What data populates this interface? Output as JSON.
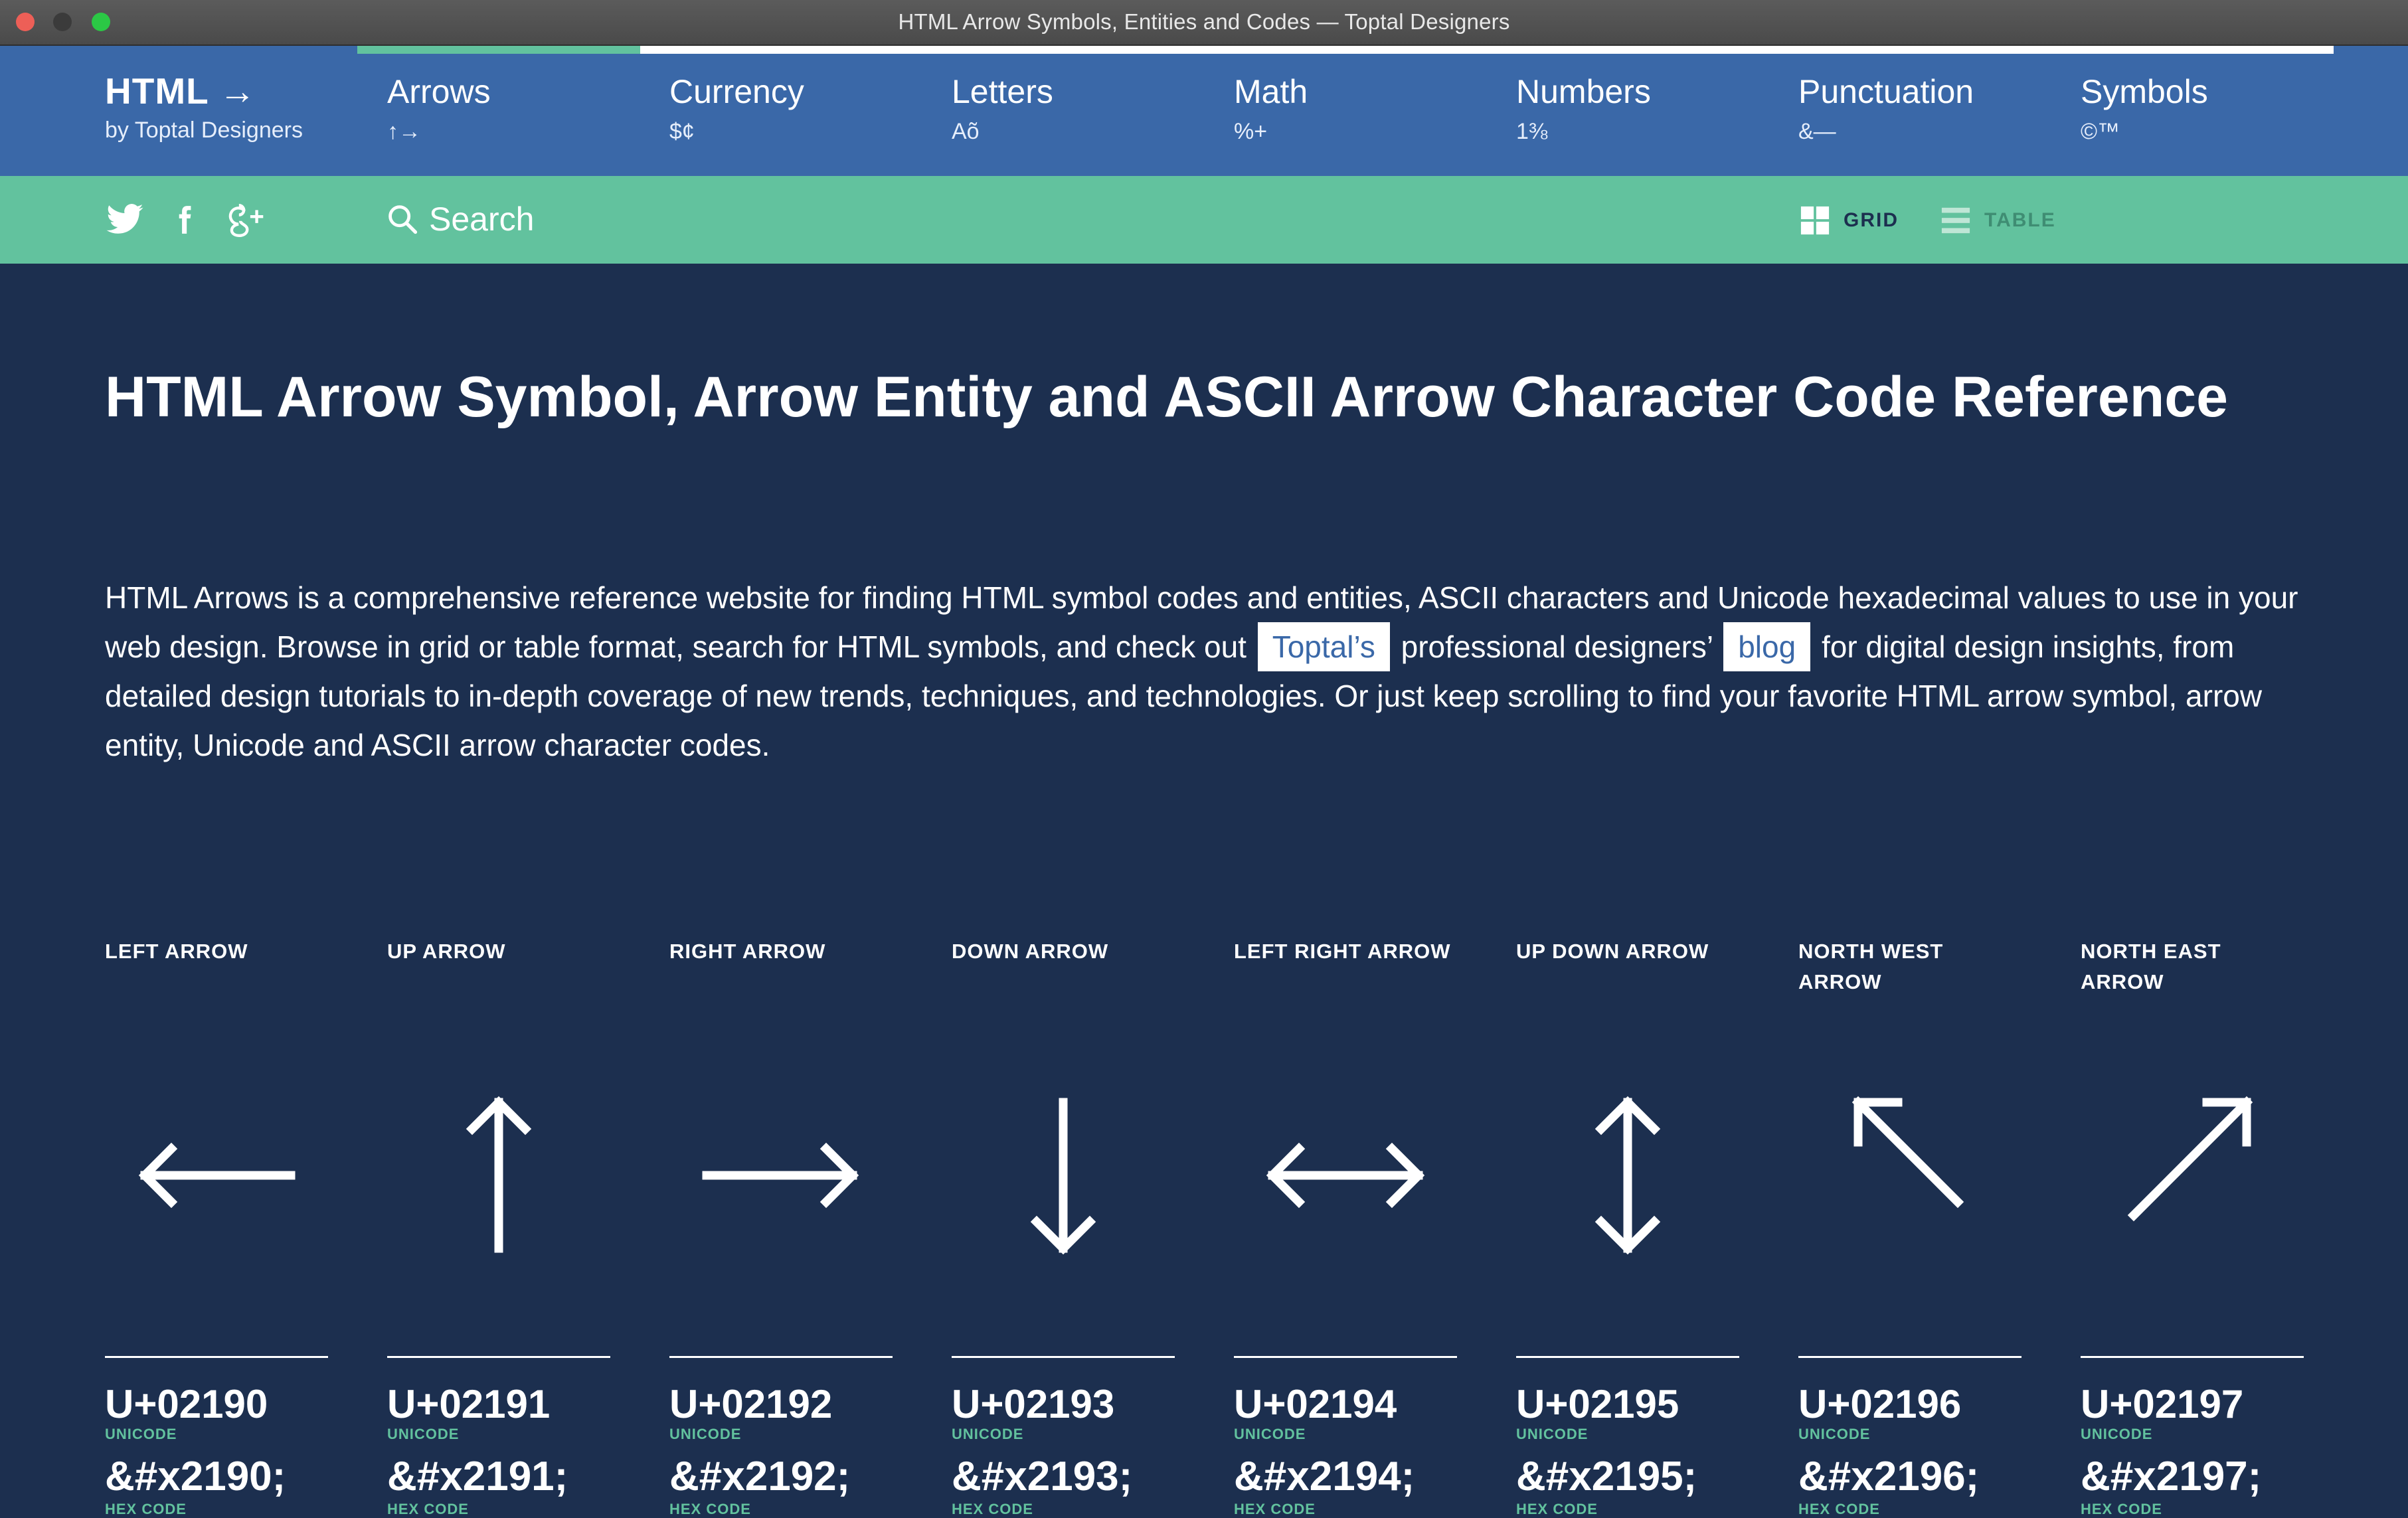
{
  "window": {
    "title": "HTML Arrow Symbols, Entities and Codes — Toptal Designers"
  },
  "brand": {
    "title": "HTML →",
    "subtitle": "by Toptal Designers"
  },
  "nav": {
    "items": [
      {
        "label": "Arrows",
        "sub": "↑→",
        "active": true
      },
      {
        "label": "Currency",
        "sub": "$¢"
      },
      {
        "label": "Letters",
        "sub": "Aõ"
      },
      {
        "label": "Math",
        "sub": "%+"
      },
      {
        "label": "Numbers",
        "sub": "1⅜"
      },
      {
        "label": "Punctuation",
        "sub": "&—"
      },
      {
        "label": "Symbols",
        "sub": "©™"
      }
    ],
    "progress_fraction": 0.143
  },
  "toolbar": {
    "social": [
      "twitter-icon",
      "facebook-icon",
      "google-plus-icon"
    ],
    "search_label": "Search",
    "grid_label": "GRID",
    "table_label": "TABLE"
  },
  "main": {
    "heading": "HTML Arrow Symbol, Arrow Entity and ASCII Arrow Character Code Reference",
    "intro_1": "HTML Arrows is a comprehensive reference website for finding HTML symbol codes and entities, ASCII characters and Unicode hexadecimal values to use in your web design. Browse in grid or table format, search for HTML symbols, and check out",
    "intro_link_1": "Toptal’s",
    "intro_2": "professional designers’",
    "intro_link_2": "blog",
    "intro_3": "for digital design insights, from detailed design tutorials to in-depth coverage of new trends, techniques, and technologies. Or just keep scrolling to find your favorite HTML arrow symbol, arrow entity, Unicode and ASCII arrow character codes."
  },
  "arrows": [
    {
      "name": "LEFT ARROW",
      "unicode": "U+02190",
      "hex": "&#x2190;",
      "icon": "left-arrow-icon"
    },
    {
      "name": "UP ARROW",
      "unicode": "U+02191",
      "hex": "&#x2191;",
      "icon": "up-arrow-icon"
    },
    {
      "name": "RIGHT ARROW",
      "unicode": "U+02192",
      "hex": "&#x2192;",
      "icon": "right-arrow-icon"
    },
    {
      "name": "DOWN ARROW",
      "unicode": "U+02193",
      "hex": "&#x2193;",
      "icon": "down-arrow-icon"
    },
    {
      "name": "LEFT RIGHT ARROW",
      "unicode": "U+02194",
      "hex": "&#x2194;",
      "icon": "left-right-arrow-icon"
    },
    {
      "name": "UP DOWN ARROW",
      "unicode": "U+02195",
      "hex": "&#x2195;",
      "icon": "up-down-arrow-icon"
    },
    {
      "name": "NORTH WEST ARROW",
      "unicode": "U+02196",
      "hex": "&#x2196;",
      "icon": "north-west-arrow-icon"
    },
    {
      "name": "NORTH EAST ARROW",
      "unicode": "U+02197",
      "hex": "&#x2197;",
      "icon": "north-east-arrow-icon"
    }
  ],
  "labels": {
    "unicode": "UNICODE",
    "hex": "HEX CODE"
  },
  "colors": {
    "nav": "#3a68a8",
    "toolbar": "#62c29e",
    "background": "#1c2f4f",
    "accent": "#62c29e"
  }
}
